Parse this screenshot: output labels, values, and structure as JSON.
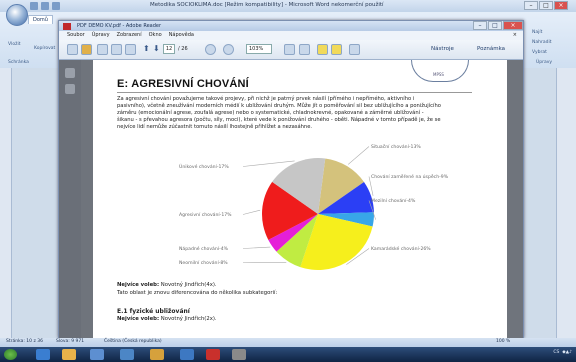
{
  "word": {
    "title": "Metodika SOCIOKLIMA.doc [Režim kompatibility] - Microsoft Word nekomerční použití",
    "ribbon_tab_home": "Domů",
    "ribbon_left_buttons": [
      "Vložit",
      "Kopírovat"
    ],
    "ribbon_left_group": "Schránka",
    "ribbon_right_buttons": [
      "Najít",
      "Nahradit",
      "Vybrat"
    ],
    "ribbon_right_group": "Úpravy",
    "status_page": "Stránka: 10 z 36",
    "status_words": "Slova: 9 971",
    "status_lang": "Čeština (Česká republika)",
    "zoom": "100 %"
  },
  "reader": {
    "title": "PDF DEMO KV.pdf - Adobe Reader",
    "menu": [
      "Soubor",
      "Úpravy",
      "Zobrazení",
      "Okno",
      "Nápověda"
    ],
    "page_current": "12",
    "page_total": "/ 26",
    "zoom": "103%",
    "tools_button": "Nástroje",
    "comment_button": "Poznámka"
  },
  "document": {
    "logo_text": "MPSS",
    "heading": "E: AGRESIVNÍ CHOVÁNÍ",
    "paragraph_lines": [
      "Za agresivní chování považujeme takové projevy, při nichž je patrný prvek násilí (přímého i nepřímého, aktivního i",
      "pasivního), včetně zneužívání moderních médií k ubližování druhým. Může jít o poměřování sil bez ubližujícího a ponižujícího",
      "záměru (emocionální agrese, zoufalá agrese) nebo o systematické, chladnokrevné, opakované a záměrné ubližování -",
      "šikanu - s převahou agresora (počtu, síly, moci), které vede k ponižování druhého - oběti. Nápadné v tomto případě je, že se",
      "nejvíce lidí nemůže zúčastnit tomuto násilí lhostejně přihlížet a nezasáhne."
    ],
    "best_choice_label": "Nejvíce voleb:",
    "best_choice_value": " Novotný Jindřich(4x).",
    "line2": "Tato oblast je znovu diferencována do několika subkategorií:",
    "subheading": "E.1 fyzické ubližování",
    "best_choice_value2": " Novotný Jindřich(2x)."
  },
  "chart_data": {
    "type": "pie",
    "series": [
      {
        "name": "Situační chování-13%",
        "value": 13,
        "color": "#d4c27c"
      },
      {
        "name": "Chování zaměřené na úspěch-9%",
        "value": 9,
        "color": "#2b3ff5"
      },
      {
        "name": "Mezilní chování-4%",
        "value": 4,
        "color": "#38a6e8"
      },
      {
        "name": "Kamarádské chování-26%",
        "value": 26,
        "color": "#f6ef1c"
      },
      {
        "name": "Neomilní chování-8%",
        "value": 8,
        "color": "#c0ec42"
      },
      {
        "name": "Nápadné chování-4%",
        "value": 4,
        "color": "#e51fd8"
      },
      {
        "name": "Agresivní chování-17%",
        "value": 17,
        "color": "#ef1c1c"
      },
      {
        "name": "Únikové chování-17%",
        "value": 17,
        "color": "#c6c6c6"
      }
    ]
  }
}
